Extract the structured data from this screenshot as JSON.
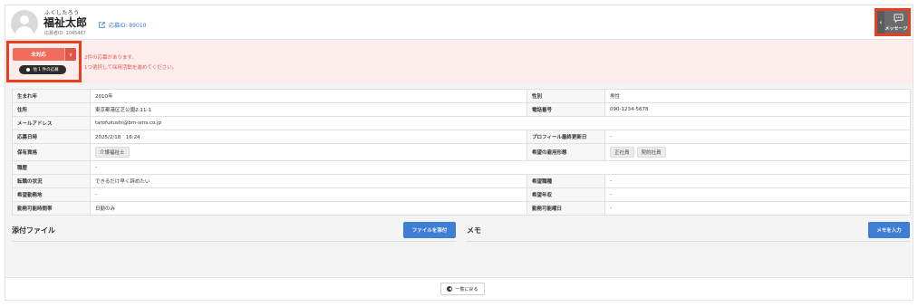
{
  "header": {
    "kana": "ふくしたろう",
    "name": "福祉太郎",
    "applicant_id": "応募者ID: 1045487",
    "ad_link": "応募ID: 89010",
    "message_label": "メッセージ",
    "collapse_glyph": "‹"
  },
  "status": {
    "selected": "未対応",
    "caret": "∨",
    "other_apps": "他 1 件の応募",
    "alert_line1": "2件の応募があります。",
    "alert_line2": "1つ選択して採用活動を進めてください。"
  },
  "profile": {
    "birth_year_label": "生まれ年",
    "birth_year": "2010年",
    "gender_label": "性別",
    "gender": "男性",
    "address_label": "住所",
    "address": "東京都港区芝公園2-11-1",
    "phone_label": "電話番号",
    "phone": "090-1234-5678",
    "email_label": "メールアドレス",
    "email": "tarofukushi@bm-sms.co.jp",
    "applied_at_label": "応募日時",
    "applied_at": "2025/2/18　16:24",
    "profile_updated_label": "プロフィール最終更新日",
    "profile_updated": "-",
    "qualification_label": "保有資格",
    "qualification_chip": "介護福祉士",
    "employment_label": "希望の雇用形態",
    "employment_chips": [
      "正社員",
      "契約社員"
    ],
    "career_label": "職歴",
    "career": "-",
    "job_change_label": "転職の状況",
    "job_change": "できるだけ早く辞めたい",
    "desired_job_label": "希望職種",
    "desired_job": "-",
    "desired_location_label": "希望勤務地",
    "desired_location": "-",
    "desired_income_label": "希望年収",
    "desired_income": "-",
    "work_hours_label": "勤務可能時間帯",
    "work_hours": "日勤のみ",
    "work_days_label": "勤務可能曜日",
    "work_days": "-"
  },
  "attachments": {
    "title": "添付ファイル",
    "button": "ファイルを添付"
  },
  "memo": {
    "title": "メモ",
    "button": "メモを入力"
  },
  "footer": {
    "back_button": "一覧に戻る",
    "back_glyph": "◀"
  },
  "colors": {
    "alert_red": "#e8401c",
    "status_red": "#f06b5c",
    "primary_blue": "#3f7ed5",
    "band_pink": "#fdecec"
  }
}
